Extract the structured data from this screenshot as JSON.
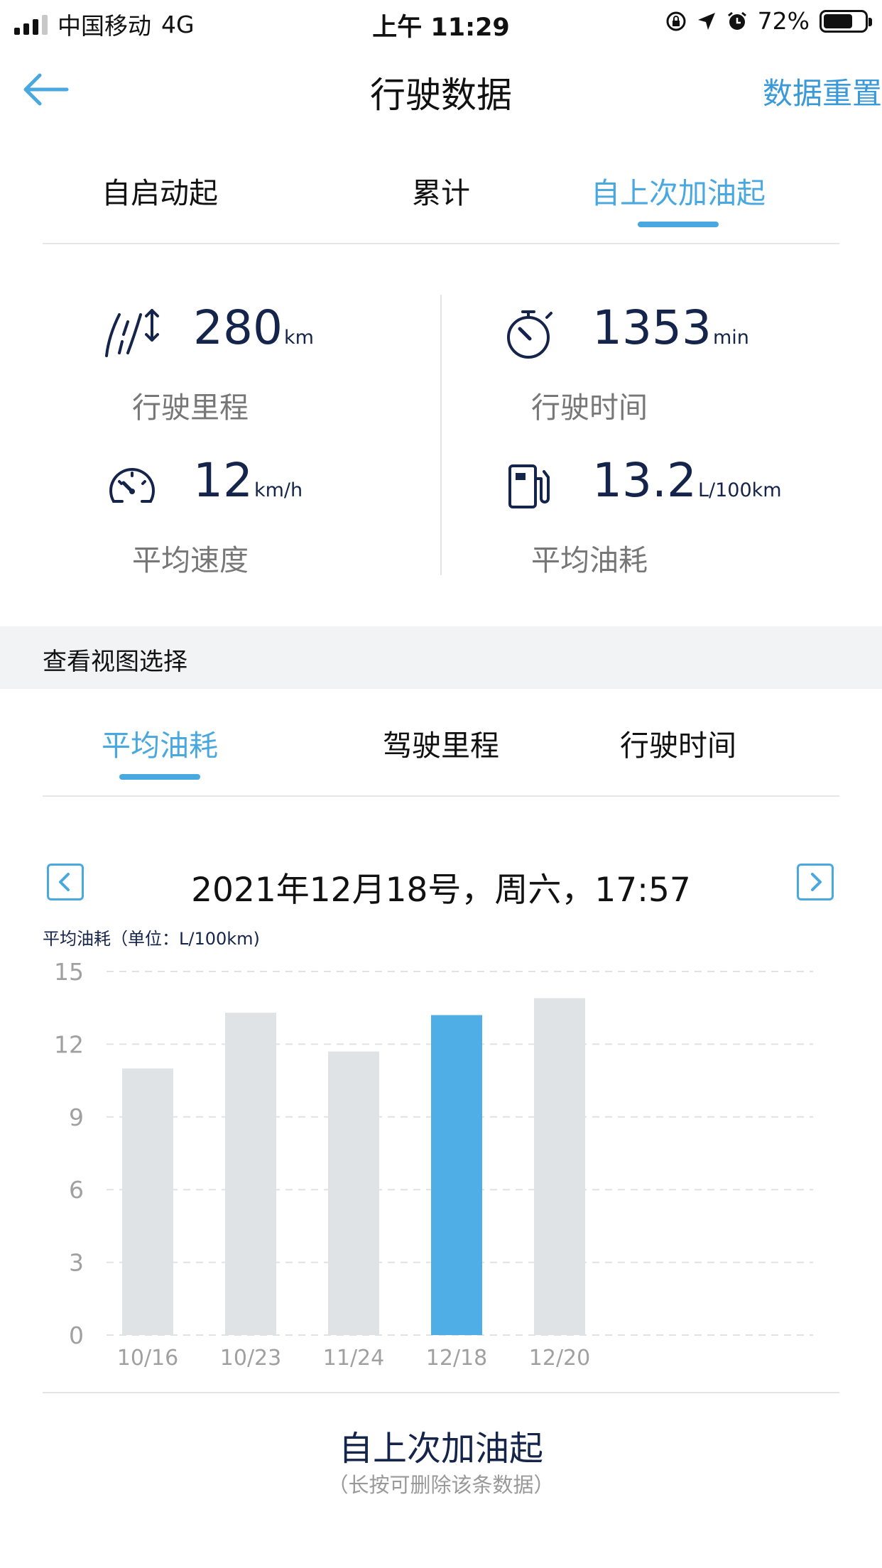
{
  "status_bar": {
    "carrier": "中国移动",
    "network": "4G",
    "time": "上午 11:29",
    "battery": "72%",
    "battery_level": 0.72
  },
  "nav": {
    "title": "行驶数据",
    "action": "数据重置",
    "back_icon": "arrow-left-icon"
  },
  "period_tabs": [
    {
      "label": "自启动起",
      "active": false
    },
    {
      "label": "累计",
      "active": false
    },
    {
      "label": "自上次加油起",
      "active": true
    }
  ],
  "stats": {
    "mileage": {
      "value": "280",
      "unit": "km",
      "label": "行驶里程",
      "icon": "road-distance-icon"
    },
    "drive_time": {
      "value": "1353",
      "unit": "min",
      "label": "行驶时间",
      "icon": "stopwatch-icon"
    },
    "avg_speed": {
      "value": "12",
      "unit": "km/h",
      "label": "平均速度",
      "icon": "speedometer-icon"
    },
    "avg_fuel": {
      "value": "13.2",
      "unit": "L/100km",
      "label": "平均油耗",
      "icon": "fuel-pump-icon"
    }
  },
  "view_section": {
    "title": "查看视图选择"
  },
  "view_tabs": [
    {
      "label": "平均油耗",
      "active": true
    },
    {
      "label": "驾驶里程",
      "active": false
    },
    {
      "label": "行驶时间",
      "active": false
    }
  ],
  "date_selector": {
    "text": "2021年12月18号，周六，17:57"
  },
  "chart_label": "平均油耗（单位：L/100km)",
  "chart_data": {
    "type": "bar",
    "categories": [
      "10/16",
      "10/23",
      "11/24",
      "12/18",
      "12/20"
    ],
    "values": [
      11.0,
      13.3,
      11.7,
      13.2,
      13.9
    ],
    "highlight_index": 3,
    "ylim": [
      0,
      15
    ],
    "yticks": [
      0,
      3,
      6,
      9,
      12,
      15
    ],
    "grid": true,
    "colors": {
      "bar": "#e0e3e6",
      "highlight": "#50aee6",
      "grid": "#e2e2e2",
      "tick": "#a0a0a0"
    }
  },
  "footer": {
    "title": "自上次加油起",
    "note": "（长按可删除该条数据）"
  },
  "colors": {
    "accent": "#49a8df",
    "value_text": "#15244a",
    "muted_text": "#777777"
  }
}
